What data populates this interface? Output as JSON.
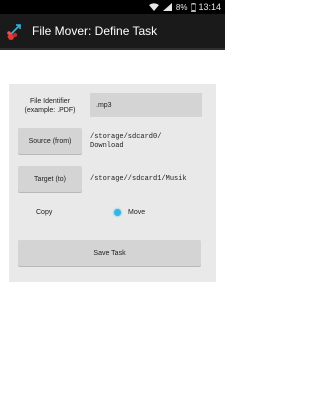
{
  "status_bar": {
    "battery_percent": "8%",
    "time": "13:14"
  },
  "action_bar": {
    "title": "File Mover: Define Task"
  },
  "form": {
    "file_identifier_label_line1": "File Identifier",
    "file_identifier_label_line2": "(example: .PDF)",
    "file_identifier_value": ".mp3",
    "source_button_label": "Source (from)",
    "source_path_line1": "/storage/sdcard0/",
    "source_path_line2": "Download",
    "target_button_label": "Target (to)",
    "target_path": "/storage//sdcard1/Musik",
    "copy_label": "Copy",
    "move_label": "Move",
    "selected_mode": "Move",
    "save_button_label": "Save Task"
  },
  "colors": {
    "accent": "#33b5e5",
    "panel": "#e9e9e9",
    "button": "#d4d4d4",
    "action_bar": "#1a1a1a"
  }
}
